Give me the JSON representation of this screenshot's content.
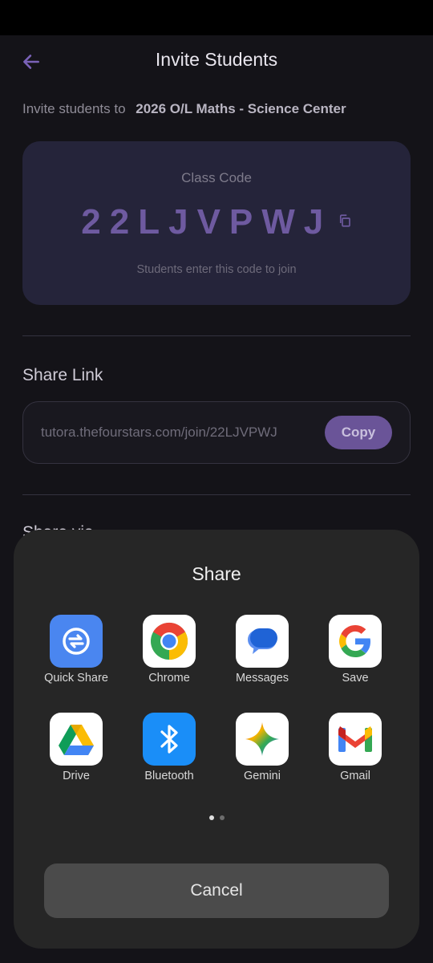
{
  "header": {
    "title": "Invite Students"
  },
  "invite": {
    "prefix": "Invite students to",
    "class_name": "2026 O/L Maths - Science Center"
  },
  "class_code": {
    "label": "Class Code",
    "code": "22LJVPWJ",
    "hint": "Students enter this code to join"
  },
  "share_link": {
    "title": "Share Link",
    "url": "tutora.thefourstars.com/join/22LJVPWJ",
    "copy_label": "Copy"
  },
  "share_via": {
    "title_partial": "Share via"
  },
  "share_sheet": {
    "title": "Share",
    "apps": [
      {
        "label": "Quick Share",
        "icon": "quick-share-icon"
      },
      {
        "label": "Chrome",
        "icon": "chrome-icon"
      },
      {
        "label": "Messages",
        "icon": "messages-icon"
      },
      {
        "label": "Save",
        "icon": "google-icon"
      },
      {
        "label": "Drive",
        "icon": "drive-icon"
      },
      {
        "label": "Bluetooth",
        "icon": "bluetooth-icon"
      },
      {
        "label": "Gemini",
        "icon": "gemini-icon"
      },
      {
        "label": "Gmail",
        "icon": "gmail-icon"
      }
    ],
    "page_count": 2,
    "active_page": 1,
    "cancel_label": "Cancel"
  },
  "colors": {
    "accent": "#6a5498",
    "background": "#141318",
    "card": "#25243a",
    "sheet": "#262626"
  }
}
